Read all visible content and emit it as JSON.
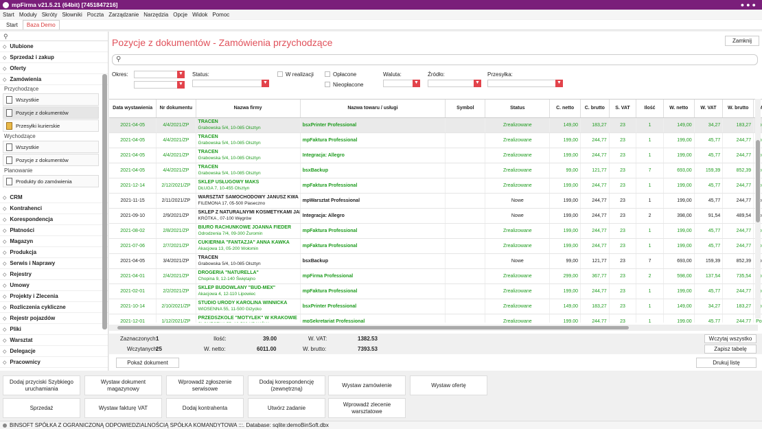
{
  "window": {
    "title": "mpFirma v21.5.21 (64bit) [7451847216]"
  },
  "menu": [
    "Start",
    "Moduły",
    "Skróty",
    "Słowniki",
    "Poczta",
    "Zarządzanie",
    "Narzędzia",
    "Opcje",
    "Widok",
    "Pomoc"
  ],
  "tabs": {
    "start": "Start",
    "baza": "Baza Demo"
  },
  "sidebar": {
    "top_sections": [
      "Ulubione",
      "Sprzedaż i zakup",
      "Oferty",
      "Zamówienia"
    ],
    "groups": {
      "przychodzace": "Przychodzące",
      "wychodzace": "Wychodzące",
      "planowanie": "Planowanie"
    },
    "przychodzace_items": [
      "Wszystkie",
      "Pozycje z dokumentów",
      "Przesyłki kurierskie"
    ],
    "wychodzace_items": [
      "Wszystkie",
      "Pozycje z dokumentów"
    ],
    "planowanie_items": [
      "Produkty do zamówienia"
    ],
    "bottom_sections": [
      "CRM",
      "Kontrahenci",
      "Korespondencja",
      "Płatności",
      "Magazyn",
      "Produkcja",
      "Serwis i Naprawy",
      "Rejestry",
      "Umowy",
      "Projekty i Zlecenia",
      "Rozliczenia cykliczne",
      "Rejestr pojazdów",
      "Pliki",
      "Warsztat",
      "Delegacje",
      "Pracownicy"
    ]
  },
  "main": {
    "title": "Pozycje z dokumentów - Zamówienia przychodzące",
    "close_label": "Zamknij",
    "filters": {
      "okres": "Okres:",
      "status": "Status:",
      "w_realizacji": "W realizacji",
      "oplacone": "Opłacone",
      "nieoplacone": "Nieopłacone",
      "waluta": "Waluta:",
      "zrodlo": "Źródło:",
      "przesylka": "Przesyłka:"
    }
  },
  "table": {
    "headers": [
      "Data wystawienia",
      "Nr dokumentu",
      "Nazwa firmy",
      "Nazwa towaru / usługi",
      "Symbol",
      "Status",
      "C. netto",
      "C. brutto",
      "S. VAT",
      "Ilość",
      "W. netto",
      "W. VAT",
      "W. brutto",
      "M"
    ],
    "rows": [
      {
        "date": "2021-04-05",
        "nr": "4/4/2021/ZP",
        "firm": "TRACEN",
        "addr": "Grabowska 5/4, 10-085 Olsztyn",
        "product": "bsxPrinter Professional",
        "status": "Zrealizowane",
        "cnetto": "149,00",
        "cbrutto": "183,27",
        "svat": "23",
        "ilosc": "1",
        "wnetto": "149,00",
        "wvat": "34,27",
        "wbrutto": "183,27",
        "m": "Pod",
        "green": true,
        "sel": true
      },
      {
        "date": "2021-04-05",
        "nr": "4/4/2021/ZP",
        "firm": "TRACEN",
        "addr": "Grabowska 5/4, 10-085 Olsztyn",
        "product": "mpFaktura Professional",
        "status": "Zrealizowane",
        "cnetto": "199,00",
        "cbrutto": "244,77",
        "svat": "23",
        "ilosc": "1",
        "wnetto": "199,00",
        "wvat": "45,77",
        "wbrutto": "244,77",
        "m": "Pod",
        "green": true
      },
      {
        "date": "2021-04-05",
        "nr": "4/4/2021/ZP",
        "firm": "TRACEN",
        "addr": "Grabowska 5/4, 10-085 Olsztyn",
        "product": "Integracja: Allegro",
        "status": "Zrealizowane",
        "cnetto": "199,00",
        "cbrutto": "244,77",
        "svat": "23",
        "ilosc": "1",
        "wnetto": "199,00",
        "wvat": "45,77",
        "wbrutto": "244,77",
        "m": "Pod",
        "green": true
      },
      {
        "date": "2021-04-05",
        "nr": "4/4/2021/ZP",
        "firm": "TRACEN",
        "addr": "Grabowska 5/4, 10-085 Olsztyn",
        "product": "bsxBackup",
        "status": "Zrealizowane",
        "cnetto": "99,00",
        "cbrutto": "121,77",
        "svat": "23",
        "ilosc": "7",
        "wnetto": "693,00",
        "wvat": "159,39",
        "wbrutto": "852,39",
        "m": "Pod",
        "green": true
      },
      {
        "date": "2021-12-14",
        "nr": "2/12/2021/ZP",
        "firm": "SKLEP USŁUGOWY MAKS",
        "addr": "DŁUGA 7, 10-455 Olsztyn",
        "product": "mpFaktura Professional",
        "status": "Zrealizowane",
        "cnetto": "199,00",
        "cbrutto": "244,77",
        "svat": "23",
        "ilosc": "1",
        "wnetto": "199,00",
        "wvat": "45,77",
        "wbrutto": "244,77",
        "m": "Pod",
        "green": true
      },
      {
        "date": "2021-11-15",
        "nr": "2/11/2021/ZP",
        "firm": "WARSZTAT SAMOCHODOWY JANUSZ KWA",
        "addr": "FILEMONA 17, 05-500 Piaseczno",
        "product": "mpWarsztat Professional",
        "status": "Nowe",
        "cnetto": "199,00",
        "cbrutto": "244,77",
        "svat": "23",
        "ilosc": "1",
        "wnetto": "199,00",
        "wvat": "45,77",
        "wbrutto": "244,77",
        "m": "Pod",
        "green": false
      },
      {
        "date": "2021-09-10",
        "nr": "2/9/2021/ZP",
        "firm": "SKLEP Z NATURALNYMI KOSMETYKAMI JAI",
        "addr": "KRÓTKA , 07-100 Węgrów",
        "product": "Integracja: Allegro",
        "status": "Nowe",
        "cnetto": "199,00",
        "cbrutto": "244,77",
        "svat": "23",
        "ilosc": "2",
        "wnetto": "398,00",
        "wvat": "91,54",
        "wbrutto": "489,54",
        "m": "Pod",
        "green": false
      },
      {
        "date": "2021-08-02",
        "nr": "2/8/2021/ZP",
        "firm": "BIURO RACHUNKOWE JOANNA FIEDER",
        "addr": "Odrodzenia 7/4, 09-300 Żuromin",
        "product": "mpFaktura Professional",
        "status": "Zrealizowane",
        "cnetto": "199,00",
        "cbrutto": "244,77",
        "svat": "23",
        "ilosc": "1",
        "wnetto": "199,00",
        "wvat": "45,77",
        "wbrutto": "244,77",
        "m": "Pod",
        "green": true
      },
      {
        "date": "2021-07-06",
        "nr": "2/7/2021/ZP",
        "firm": "CUKIERNIA \"FANTAZJA\" ANNA KAWKA",
        "addr": "Akacjowa 13, 05-200 Wołomin",
        "product": "mpFaktura Professional",
        "status": "Zrealizowane",
        "cnetto": "199,00",
        "cbrutto": "244,77",
        "svat": "23",
        "ilosc": "1",
        "wnetto": "199,00",
        "wvat": "45,77",
        "wbrutto": "244,77",
        "m": "Pod",
        "green": true
      },
      {
        "date": "2021-04-05",
        "nr": "3/4/2021/ZP",
        "firm": "TRACEN",
        "addr": "Grabowska 5/4, 10-085 Olsztyn",
        "product": "bsxBackup",
        "status": "Nowe",
        "cnetto": "99,00",
        "cbrutto": "121,77",
        "svat": "23",
        "ilosc": "7",
        "wnetto": "693,00",
        "wvat": "159,39",
        "wbrutto": "852,39",
        "m": "Pod",
        "green": false
      },
      {
        "date": "2021-04-01",
        "nr": "2/4/2021/ZP",
        "firm": "DROGERIA \"NATURELLA\"",
        "addr": "Chopina 9, 12-140 Świętajno",
        "product": "mpFirma Professional",
        "status": "Zrealizowane",
        "cnetto": "299,00",
        "cbrutto": "367,77",
        "svat": "23",
        "ilosc": "2",
        "wnetto": "598,00",
        "wvat": "137,54",
        "wbrutto": "735,54",
        "m": "Pod",
        "green": true
      },
      {
        "date": "2021-02-01",
        "nr": "2/2/2021/ZP",
        "firm": "SKLEP BUDOWLANY \"BUD-MEX\"",
        "addr": "Akacjowa 4, 12-110 Lipowiec",
        "product": "mpFaktura Professional",
        "status": "Zrealizowane",
        "cnetto": "199,00",
        "cbrutto": "244,77",
        "svat": "23",
        "ilosc": "1",
        "wnetto": "199,00",
        "wvat": "45,77",
        "wbrutto": "244,77",
        "m": "Pod",
        "green": true
      },
      {
        "date": "2021-10-14",
        "nr": "2/10/2021/ZP",
        "firm": "STUDIO URODY KAROLINA WINNICKA",
        "addr": "WIOSENNA 55, 11-500 Giżycko",
        "product": "bsxPrinter Professional",
        "status": "Zrealizowane",
        "cnetto": "149,00",
        "cbrutto": "183,27",
        "svat": "23",
        "ilosc": "1",
        "wnetto": "149,00",
        "wvat": "34,27",
        "wbrutto": "183,27",
        "m": "Pod",
        "green": true
      },
      {
        "date": "2021-12-01",
        "nr": "1/12/2021/ZP",
        "firm": "PRZEDSZKOLE \"MOTYLEK\" W KRAKOWIE",
        "addr": "SŁONECZNA 55, 12-500 KRAKÓW",
        "product": "mpSekretariat Professional",
        "status": "Zrealizowane",
        "cnetto": "199,00",
        "cbrutto": "244,77",
        "svat": "23",
        "ilosc": "1",
        "wnetto": "199,00",
        "wvat": "45,77",
        "wbrutto": "244,77",
        "m": "Pod",
        "green": true
      }
    ]
  },
  "summary": {
    "zaznaczonych_label": "Zaznaczonych:",
    "zaznaczonych": "1",
    "wczytanych_label": "Wczytanych:",
    "wczytanych": "25",
    "ilosc_label": "Ilość:",
    "ilosc": "39.00",
    "wnetto_label": "W. netto:",
    "wnetto": "6011.00",
    "wvat_label": "W. VAT:",
    "wvat": "1382.53",
    "wbrutto_label": "W. brutto:",
    "wbrutto": "7393.53",
    "wczytaj": "Wczytaj wszystko",
    "zapisz": "Zapisz tabelę",
    "pokaz": "Pokaż dokument",
    "drukuj": "Drukuj listę"
  },
  "quick_buttons": {
    "row1": [
      "Dodaj przyciski Szybkiego uruchamiania",
      "Wystaw dokument magazynowy",
      "Wprowadź zgłoszenie serwisowe",
      "Dodaj korespondencję (zewnętrzną)",
      "Wystaw zamówienie",
      "Wystaw ofertę"
    ],
    "row2": [
      "Sprzedaż",
      "Wystaw fakturę VAT",
      "Dodaj kontrahenta",
      "Utwórz zadanie",
      "Wprowadź zlecenie warsztatowe"
    ]
  },
  "statusbar": "BINSOFT SPÓŁKA Z OGRANICZONĄ ODPOWIEDZIALNOŚCIĄ SPÓŁKA KOMANDYTOWA :::. Database: sqlite:demoBinSoft.dbx",
  "colors": {
    "title_bar": "#7a1f7a",
    "accent": "#e0505a",
    "dropdown": "#e2434b",
    "done": "#1d9b1d"
  }
}
